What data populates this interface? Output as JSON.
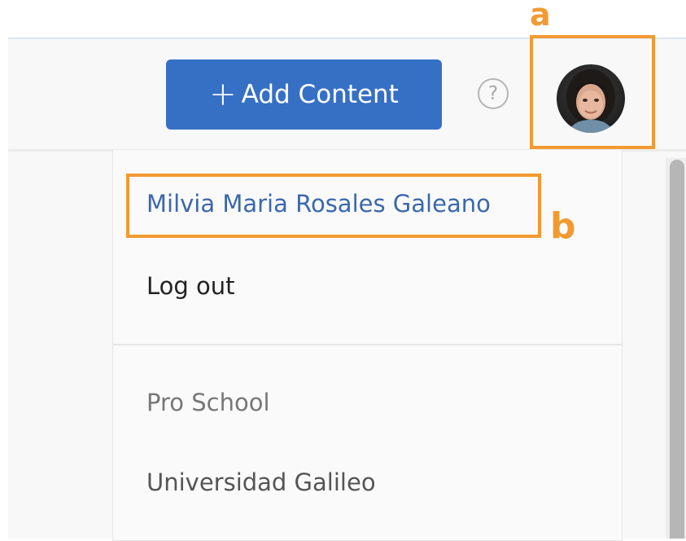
{
  "header": {
    "add_content_label": "Add Content",
    "help_icon": "question-circle-icon"
  },
  "user_menu": {
    "user_name": "Milvia Maria Rosales Galeano",
    "logout_label": "Log out",
    "organizations": [
      "Pro School",
      "Universidad Galileo"
    ]
  },
  "callouts": {
    "a": "a",
    "b": "b"
  },
  "colors": {
    "accent_button": "#3670c4",
    "user_link": "#3b68ad",
    "callout": "#f29a32"
  }
}
